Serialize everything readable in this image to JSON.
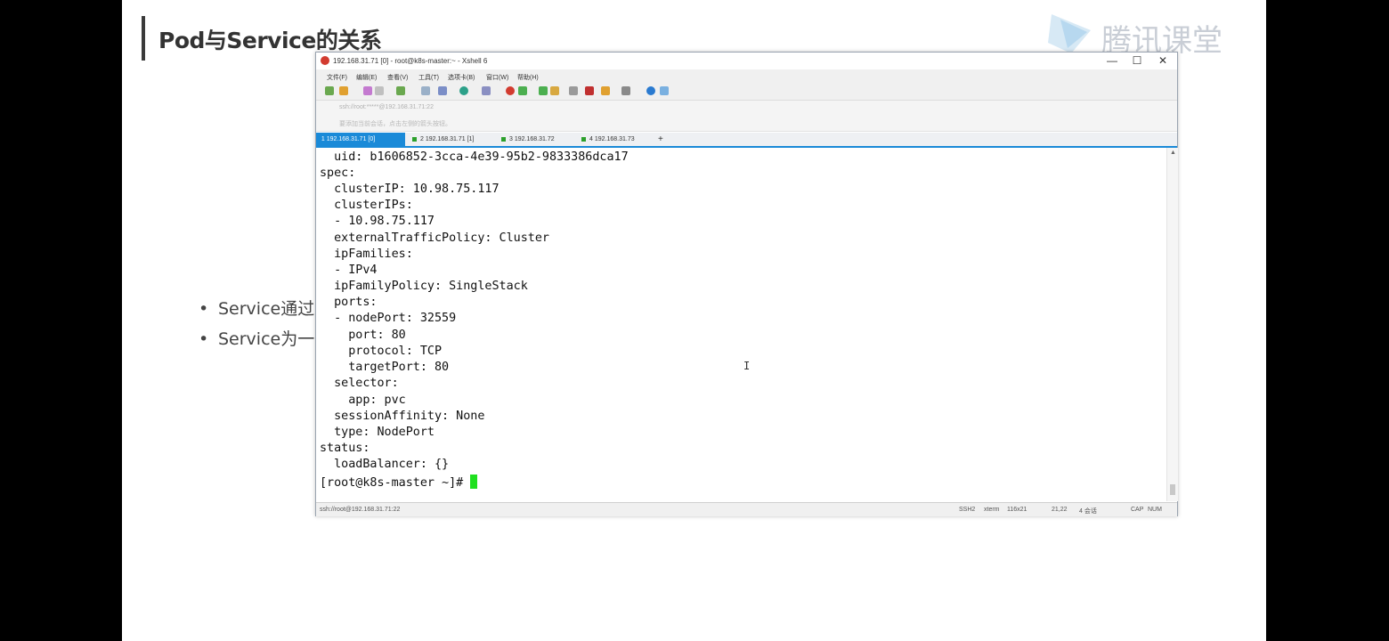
{
  "slide": {
    "title": "Pod与Service的关系",
    "logo_text": "腾讯课堂",
    "bullets": [
      "Service通过",
      "Service为一"
    ]
  },
  "xshell": {
    "window_title": "192.168.31.71 [0] - root@k8s-master:~ - Xshell 6",
    "minimize": "—",
    "maximize": "☐",
    "close": "✕",
    "menu": [
      "文件(F)",
      "编辑(E)",
      "查看(V)",
      "工具(T)",
      "选项卡(B)",
      "窗口(W)",
      "帮助(H)"
    ],
    "address": "ssh://root:*****@192.168.31.71:22",
    "hint": "要添加当前会话，点击左侧的箭头按钮。",
    "tabs": [
      {
        "num": "1",
        "label": "192.168.31.71 [0]"
      },
      {
        "num": "2",
        "label": "192.168.31.71 [1]"
      },
      {
        "num": "3",
        "label": "192.168.31.72"
      },
      {
        "num": "4",
        "label": "192.168.31.73"
      }
    ],
    "add_tab": "+",
    "terminal_lines": [
      "  uid: b1606852-3cca-4e39-95b2-9833386dca17",
      "spec:",
      "  clusterIP: 10.98.75.117",
      "  clusterIPs:",
      "  - 10.98.75.117",
      "  externalTrafficPolicy: Cluster",
      "  ipFamilies:",
      "  - IPv4",
      "  ipFamilyPolicy: SingleStack",
      "  ports:",
      "  - nodePort: 32559",
      "    port: 80",
      "    protocol: TCP",
      "    targetPort: 80",
      "  selector:",
      "    app: pvc",
      "  sessionAffinity: None",
      "  type: NodePort",
      "status:",
      "  loadBalancer: {}"
    ],
    "prompt": "[root@k8s-master ~]# ",
    "ibeam": "I",
    "status": {
      "left": "ssh://root@192.168.31.71:22",
      "ssh": "SSH2",
      "term": "xterm",
      "size": "116x21",
      "pos": "21,22",
      "sessions": "4 会话",
      "cap": "CAP",
      "num": "NUM"
    }
  }
}
